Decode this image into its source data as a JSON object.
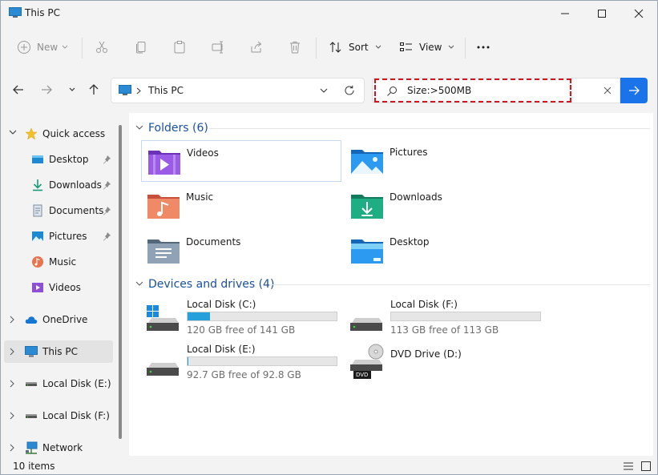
{
  "window": {
    "title": "This PC",
    "controls": [
      "minimize-icon",
      "maximize-icon",
      "close-icon"
    ]
  },
  "toolbar": {
    "new_label": "New",
    "sort_label": "Sort",
    "view_label": "View",
    "more_icon": "ellipsis-icon",
    "icons": [
      "cut-icon",
      "copy-icon",
      "paste-icon",
      "rename-icon",
      "share-icon",
      "delete-icon"
    ]
  },
  "address": {
    "location": "This PC"
  },
  "search": {
    "query": "Size:>500MB"
  },
  "sidebar": {
    "quick_access": "Quick access",
    "items": [
      {
        "label": "Desktop",
        "pinned": true
      },
      {
        "label": "Downloads",
        "pinned": true
      },
      {
        "label": "Documents",
        "pinned": true
      },
      {
        "label": "Pictures",
        "pinned": true
      },
      {
        "label": "Music",
        "pinned": false
      },
      {
        "label": "Videos",
        "pinned": false
      }
    ],
    "onedrive": "OneDrive",
    "this_pc": "This PC",
    "local_e": "Local Disk (E:)",
    "local_f": "Local Disk (F:)",
    "network": "Network"
  },
  "folders": {
    "header": "Folders (6)",
    "items": [
      "Videos",
      "Pictures",
      "Music",
      "Downloads",
      "Documents",
      "Desktop"
    ]
  },
  "drives": {
    "header": "Devices and drives (4)",
    "items": [
      {
        "label": "Local Disk (C:)",
        "free": "120 GB free of 141 GB",
        "used_fraction": 0.149
      },
      {
        "label": "Local Disk (F:)",
        "free": "113 GB free of 113 GB",
        "used_fraction": 0.0
      },
      {
        "label": "Local Disk (E:)",
        "free": "92.7 GB free of 92.8 GB",
        "used_fraction": 0.001
      },
      {
        "label": "DVD Drive (D:)",
        "badge": "DVD"
      }
    ]
  },
  "status": {
    "count": "10 items"
  },
  "colors": {
    "accent": "#1a73e8",
    "header_blue": "#1a4f9c",
    "drive_fill": "#26a0da",
    "highlight": "#e0101a"
  }
}
